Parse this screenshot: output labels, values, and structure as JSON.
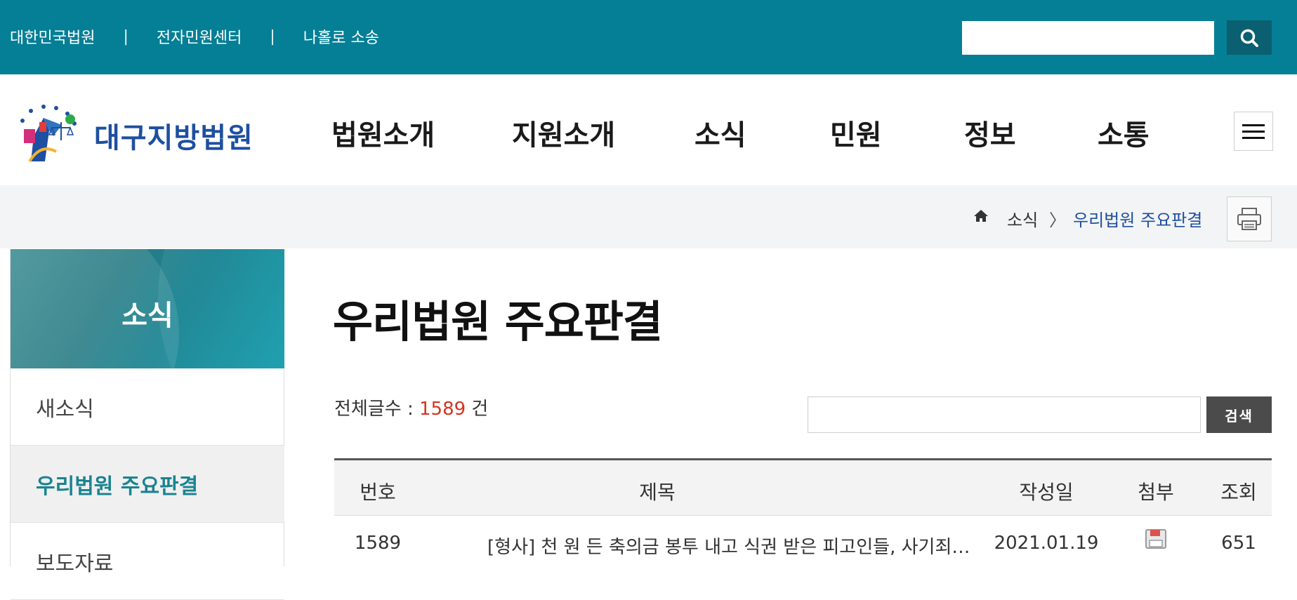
{
  "top_links": [
    "대한민국법원",
    "전자민원센터",
    "나홀로 소송"
  ],
  "top_links_separator": "|",
  "top_search": {
    "value": ""
  },
  "logo": {
    "text": "대구지방법원"
  },
  "gnb": [
    "법원소개",
    "지원소개",
    "소식",
    "민원",
    "정보",
    "소통"
  ],
  "breadcrumb": {
    "level1": "소식",
    "separator": "〉",
    "current": "우리법원 주요판결"
  },
  "side_nav": {
    "title": "소식",
    "items": [
      "새소식",
      "우리법원 주요판결",
      "보도자료"
    ],
    "active_index": 1
  },
  "page_title": "우리법원 주요판결",
  "count": {
    "label": "전체글수 : ",
    "value": "1589",
    "unit": " 건"
  },
  "search": {
    "value": "",
    "button_label": "검색"
  },
  "table": {
    "headers": [
      "번호",
      "제목",
      "작성일",
      "첨부",
      "조회"
    ],
    "rows": [
      {
        "no": "1589",
        "title": "[형사] 천 원 든 축의금 봉투 내고 식권 받은 피고인들, 사기죄 인정…",
        "date": "2021.01.19",
        "attach": "file-icon",
        "views": "651"
      }
    ]
  },
  "colors": {
    "top_bar": "#057f96",
    "accent": "#1a8391",
    "link_blue": "#1e4fa0",
    "count_red": "#d5341f"
  }
}
